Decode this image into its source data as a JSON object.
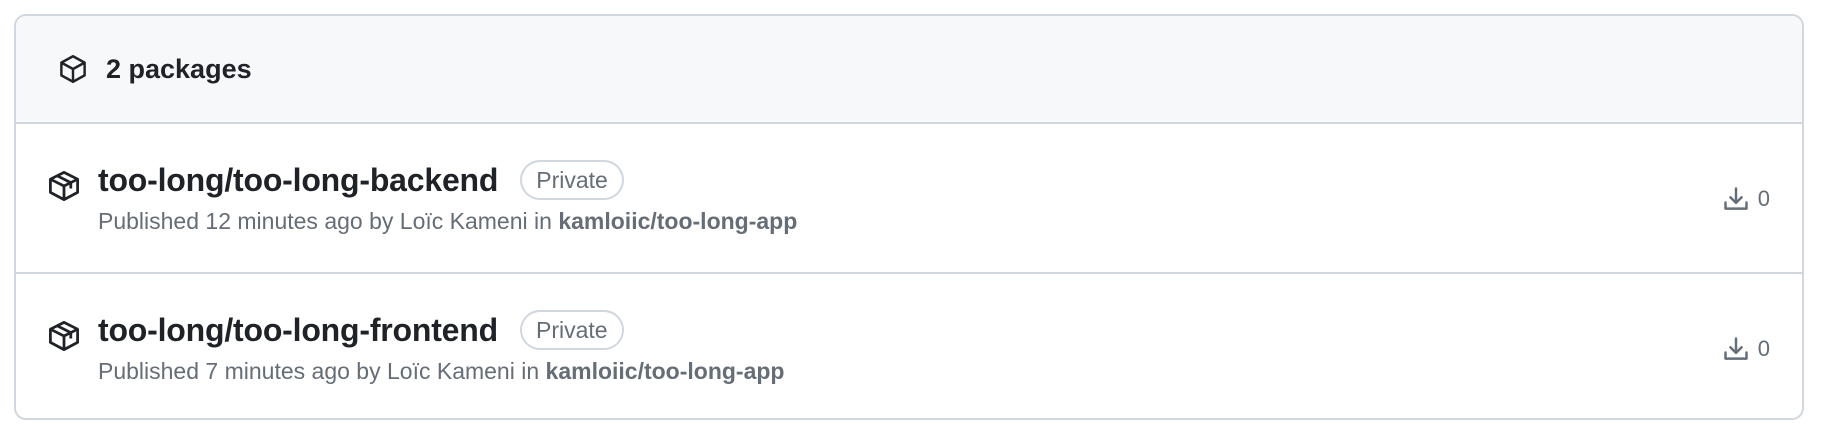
{
  "header": {
    "count_label": "2 packages"
  },
  "packages": [
    {
      "name": "too-long/too-long-backend",
      "visibility": "Private",
      "published_prefix": "Published",
      "published_time": "12 minutes ago",
      "by_label": "by",
      "author": "Loïc Kameni",
      "in_label": "in",
      "repo": "kamloiic/too-long-app",
      "downloads": "0"
    },
    {
      "name": "too-long/too-long-frontend",
      "visibility": "Private",
      "published_prefix": "Published",
      "published_time": "7 minutes ago",
      "by_label": "by",
      "author": "Loïc Kameni",
      "in_label": "in",
      "repo": "kamloiic/too-long-app",
      "downloads": "0"
    }
  ],
  "colors": {
    "border": "#d0d7de",
    "header_bg": "#f6f8fa",
    "text_primary": "#1f2328",
    "text_muted": "#656d76"
  },
  "icons": {
    "header": "package-icon",
    "row": "package-icon",
    "downloads": "download-icon"
  }
}
